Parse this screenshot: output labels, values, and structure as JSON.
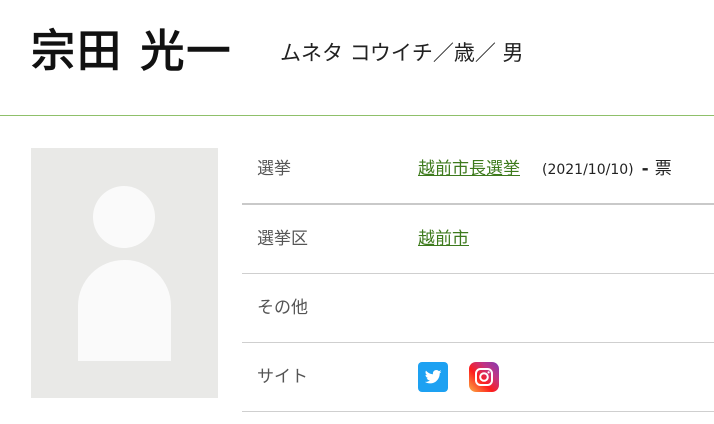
{
  "candidate": {
    "name": "宗田 光一",
    "kana_age_gender": "ムネタ コウイチ／歳／ 男"
  },
  "profile": {
    "rows": [
      {
        "label": "選挙",
        "election_link": "越前市長選挙",
        "election_date": "(2021/10/10)",
        "dash": "-",
        "votes": "票"
      },
      {
        "label": "選挙区",
        "district_link": "越前市"
      },
      {
        "label": "その他",
        "value": ""
      },
      {
        "label": "サイト",
        "icons": [
          "twitter-icon",
          "instagram-icon"
        ]
      }
    ]
  },
  "colors": {
    "link": "#3d7a1c",
    "header_border": "#8fc06a",
    "twitter": "#1da1f2"
  }
}
